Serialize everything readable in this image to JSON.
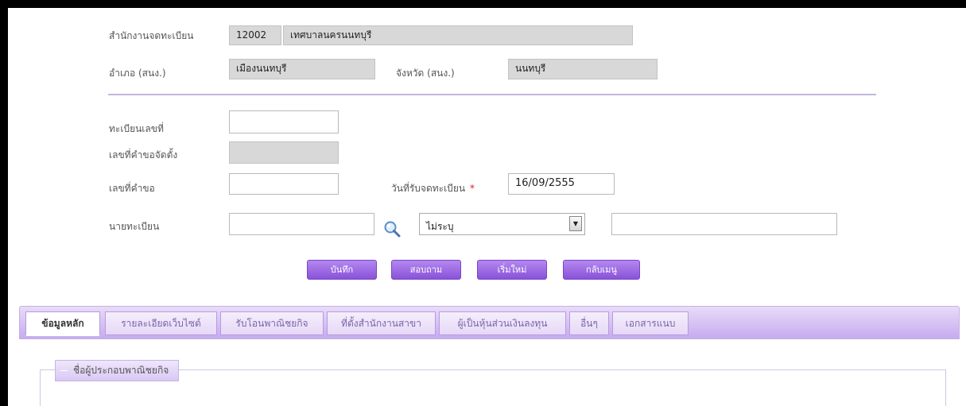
{
  "header": {
    "registrar_office_label": "สำนักงานจดทะเบียน",
    "registrar_office_code": "12002",
    "registrar_office_name": "เทศบาลนครนนทบุรี",
    "district_label": "อำเภอ (สนง.)",
    "district_value": "เมืองนนทบุรี",
    "province_label": "จังหวัด (สนง.)",
    "province_value": "นนทบุรี"
  },
  "form": {
    "registration_no_label": "ทะเบียนเลขที่",
    "registration_no_value": "",
    "setup_request_no_label": "เลขที่คำขอจัดตั้ง",
    "setup_request_no_value": "",
    "request_no_label": "เลขที่คำขอ",
    "request_no_value": "",
    "registration_date_label": "วันที่รับจดทะเบียน",
    "required_mark": "*",
    "registration_date_value": "16/09/2555",
    "registrar_label": "นายทะเบียน",
    "registrar_value": "",
    "registrar_select": "ไม่ระบุ",
    "registrar_name_value": ""
  },
  "buttons": {
    "save": "บันทึก",
    "query": "สอบถาม",
    "new": "เริ่มใหม่",
    "back_menu": "กลับเมนู"
  },
  "tabs": [
    {
      "label": "ข้อมูลหลัก",
      "active": true
    },
    {
      "label": "รายละเอียดเว็บไซต์",
      "active": false
    },
    {
      "label": "รับโอนพาณิชยกิจ",
      "active": false
    },
    {
      "label": "ที่ตั้งสำนักงานสาขา",
      "active": false
    },
    {
      "label": "ผู้เป็นหุ้นส่วนเงินลงทุน",
      "active": false
    },
    {
      "label": "อื่นๆ",
      "active": false
    },
    {
      "label": "เอกสารแนบ",
      "active": false
    }
  ],
  "section": {
    "legend": "ชื่อผู้ประกอบพาณิชยกิจ"
  },
  "colors": {
    "accent": "#9b6ee0",
    "tab_bar": "#d5c0f2",
    "divider": "#c5b8d9"
  },
  "icons": {
    "search": "magnifier-icon",
    "select_arrow": "chevron-down-icon"
  }
}
